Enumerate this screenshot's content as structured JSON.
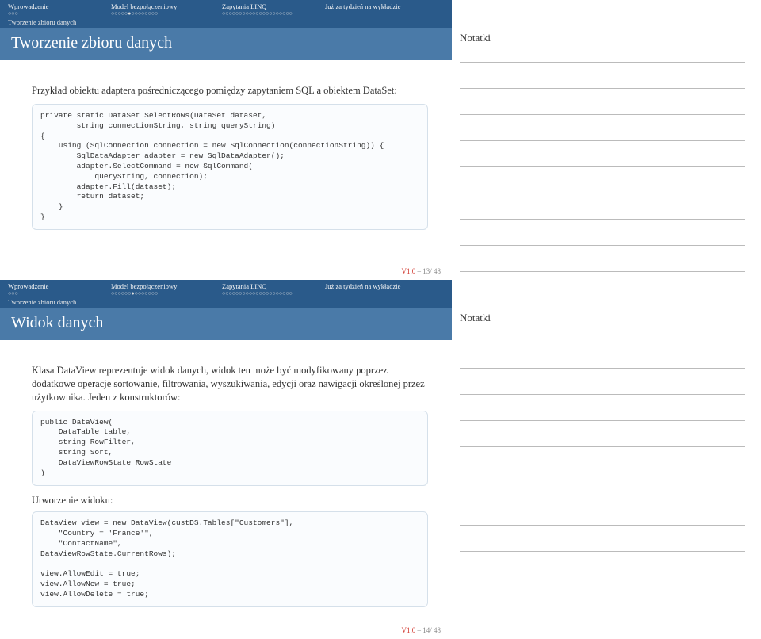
{
  "slides": [
    {
      "nav": {
        "items": [
          {
            "label": "Wprowadzenie",
            "dots": "○○○"
          },
          {
            "label": "Model bezpołączeniowy",
            "dots": "○○○○○●○○○○○○○○"
          },
          {
            "label": "Zapytania LINQ",
            "dots": "○○○○○○○○○○○○○○○○○○○○○"
          },
          {
            "label": "Już za tydzień na wykładzie",
            "dots": ""
          }
        ],
        "subsection": "Tworzenie zbioru danych"
      },
      "title": "Tworzenie zbioru danych",
      "notes": "Notatki",
      "body_text": "Przykład obiektu adaptera pośredniczącego pomiędzy zapytaniem SQL a obiektem DataSet:",
      "code": "private static DataSet SelectRows(DataSet dataset,\n        string connectionString, string queryString)\n{\n    using (SqlConnection connection = new SqlConnection(connectionString)) {\n        SqlDataAdapter adapter = new SqlDataAdapter();\n        adapter.SelectCommand = new SqlCommand(\n            queryString, connection);\n        adapter.Fill(dataset);\n        return dataset;\n    }\n}",
      "footer": {
        "version": "V1.0",
        "page": "13/ 48"
      }
    },
    {
      "nav": {
        "items": [
          {
            "label": "Wprowadzenie",
            "dots": "○○○"
          },
          {
            "label": "Model bezpołączeniowy",
            "dots": "○○○○○○●○○○○○○○"
          },
          {
            "label": "Zapytania LINQ",
            "dots": "○○○○○○○○○○○○○○○○○○○○○"
          },
          {
            "label": "Już za tydzień na wykładzie",
            "dots": ""
          }
        ],
        "subsection": "Tworzenie zbioru danych"
      },
      "title": "Widok danych",
      "notes": "Notatki",
      "body_text": "Klasa DataView reprezentuje widok danych, widok ten może być modyfikowany poprzez dodatkowe operacje sortowanie, filtrowania, wyszukiwania, edycji oraz nawigacji określonej przez użytkownika. Jeden z konstruktorów:",
      "code1": "public DataView(\n    DataTable table,\n    string RowFilter,\n    string Sort,\n    DataViewRowState RowState\n)",
      "sub_head": "Utworzenie widoku:",
      "code2": "DataView view = new DataView(custDS.Tables[\"Customers\"],\n    \"Country = 'France'\",\n    \"ContactName\",\nDataViewRowState.CurrentRows);\n\nview.AllowEdit = true;\nview.AllowNew = true;\nview.AllowDelete = true;",
      "footer": {
        "version": "V1.0",
        "page": "14/ 48"
      }
    }
  ]
}
